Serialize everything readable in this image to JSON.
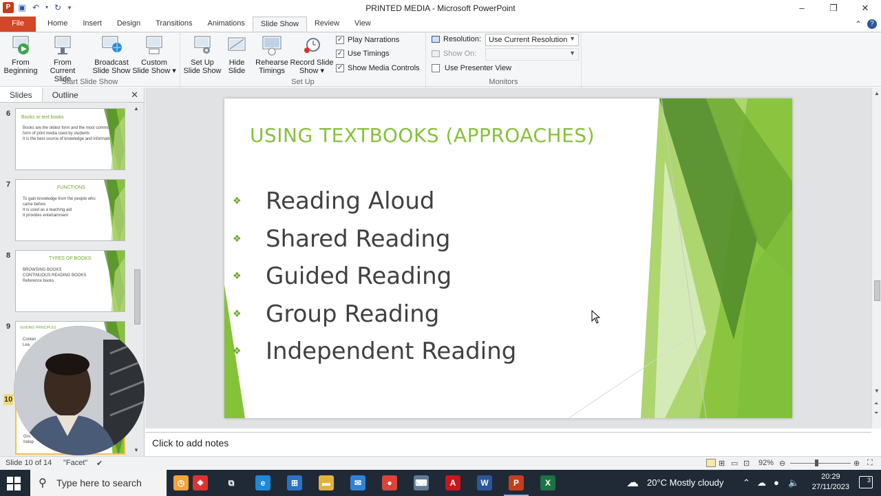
{
  "window": {
    "title": "PRINTED MEDIA  -  Microsoft PowerPoint",
    "controls": [
      "–",
      "❐",
      "✕"
    ]
  },
  "qat": {
    "app_icon": "P",
    "save": "save-icon",
    "undo": "undo-icon",
    "redo": "redo-icon"
  },
  "ribbon_tabs": [
    "File",
    "Home",
    "Insert",
    "Design",
    "Transitions",
    "Animations",
    "Slide Show",
    "Review",
    "View"
  ],
  "active_tab": "Slide Show",
  "ribbon": {
    "start_group": {
      "label": "Start Slide Show",
      "from_beginning": [
        "From",
        "Beginning"
      ],
      "from_current": [
        "From",
        "Current Slide"
      ],
      "broadcast": [
        "Broadcast",
        "Slide Show"
      ],
      "custom": [
        "Custom",
        "Slide Show ▾"
      ]
    },
    "setup_group": {
      "label": "Set Up",
      "setup": [
        "Set Up",
        "Slide Show"
      ],
      "hide": [
        "Hide",
        "Slide"
      ],
      "rehearse": [
        "Rehearse",
        "Timings"
      ],
      "record": [
        "Record Slide",
        "Show ▾"
      ],
      "play_narrations": "Play Narrations",
      "use_timings": "Use Timings",
      "show_media_controls": "Show Media Controls"
    },
    "monitors_group": {
      "label": "Monitors",
      "resolution_label": "Resolution:",
      "resolution_value": "Use Current Resolution",
      "show_on_label": "Show On:",
      "use_presenter_view": "Use Presenter View"
    }
  },
  "panel": {
    "tabs": [
      "Slides",
      "Outline"
    ],
    "close": "✕",
    "slides": [
      {
        "num": "6",
        "title": "Books or text books",
        "bullets": [
          "Books are the oldest form and the most common form of print media used by students",
          "It is the best source of knowledge and information"
        ]
      },
      {
        "num": "7",
        "title": "FUNCTIONS",
        "bullets": [
          "To gain knowledge from the people who came before",
          "It is used as a teaching aid",
          "It provides entertainment"
        ]
      },
      {
        "num": "8",
        "title": "TYPES OF BOOKS",
        "bullets": [
          "BROWSING BOOKS",
          "CONTINUOUS READING BOOKS",
          "Reference books"
        ]
      },
      {
        "num": "9",
        "title": "GUIDING PRINCIPLES",
        "bullets": [
          "Conten",
          "Lea"
        ]
      },
      {
        "num": "10",
        "title": "",
        "bullets": [
          "Gro",
          "Indep"
        ]
      }
    ]
  },
  "slide": {
    "title": "USING TEXTBOOKS (APPROACHES)",
    "bullet_mark": "❖",
    "bullets": [
      "Reading Aloud",
      "Shared Reading",
      "Guided Reading",
      "Group Reading",
      "Independent Reading"
    ]
  },
  "notes": {
    "placeholder": "Click to add notes"
  },
  "status": {
    "slide_count": "Slide 10 of 14",
    "theme": "\"Facet\"",
    "zoom": "92%"
  },
  "taskbar": {
    "search_placeholder": "Type here to search",
    "weather": "20°C  Mostly cloudy",
    "time": "20:29",
    "date": "27/11/2023",
    "notifications": "3",
    "apps": [
      {
        "name": "task-view",
        "glyph": "⧉",
        "color": "#1f2a36"
      },
      {
        "name": "edge",
        "glyph": "e",
        "color": "#1c8ad6"
      },
      {
        "name": "store",
        "glyph": "⊞",
        "color": "#2a73c7"
      },
      {
        "name": "file-explorer",
        "glyph": "▬",
        "color": "#e2b23a"
      },
      {
        "name": "mail",
        "glyph": "✉",
        "color": "#2f83d8"
      },
      {
        "name": "chrome",
        "glyph": "●",
        "color": "#db4437"
      },
      {
        "name": "keyboard",
        "glyph": "⌨",
        "color": "#5f7b94"
      },
      {
        "name": "acrobat",
        "glyph": "A",
        "color": "#c8171e"
      },
      {
        "name": "word",
        "glyph": "W",
        "color": "#2b579a"
      },
      {
        "name": "powerpoint",
        "glyph": "P",
        "color": "#c43e1c"
      },
      {
        "name": "excel",
        "glyph": "X",
        "color": "#1f7244"
      }
    ]
  },
  "colors": {
    "accent": "#86c13a",
    "file_tab": "#d24726",
    "dark_green": "#4f8a2a"
  }
}
